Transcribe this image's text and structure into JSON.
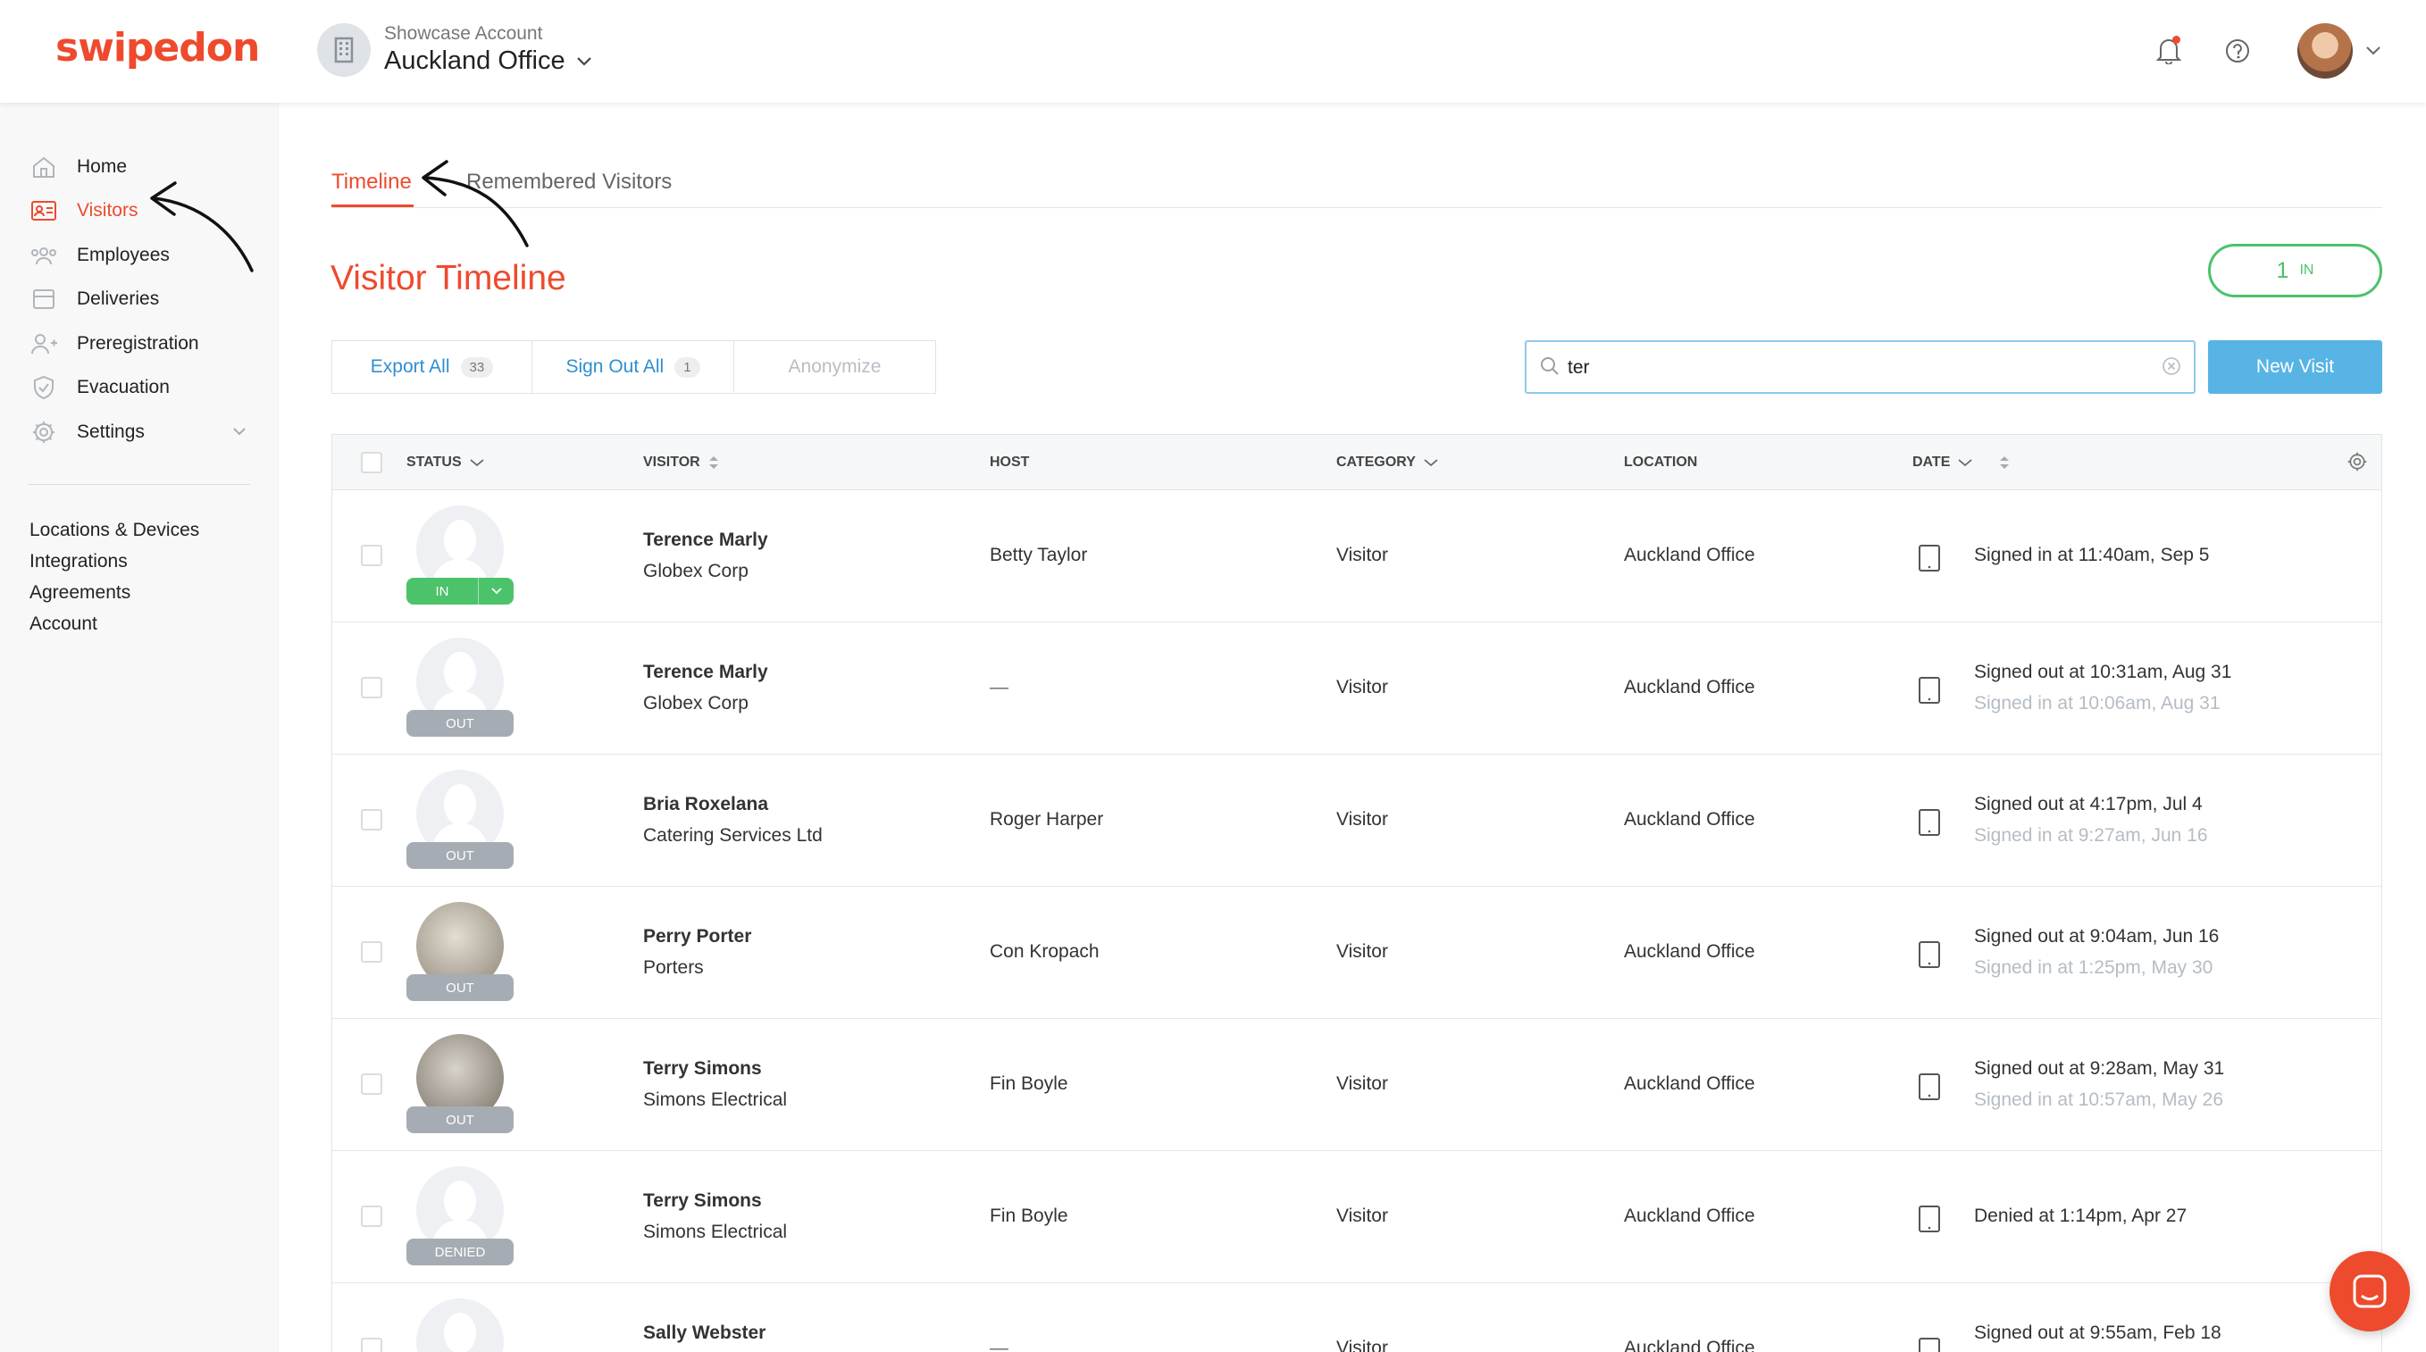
{
  "brand": {
    "logo_text": "swipedon",
    "accent": "#ee4a2d"
  },
  "header": {
    "account_label": "Showcase Account",
    "location_title": "Auckland Office",
    "icons": [
      "building-icon",
      "chevron-down-icon",
      "bell-icon",
      "help-icon",
      "avatar",
      "chevron-down-icon"
    ]
  },
  "sidebar": {
    "items": [
      {
        "label": "Home",
        "icon": "home-icon"
      },
      {
        "label": "Visitors",
        "icon": "visitor-card-icon"
      },
      {
        "label": "Employees",
        "icon": "people-icon"
      },
      {
        "label": "Deliveries",
        "icon": "box-icon"
      },
      {
        "label": "Preregistration",
        "icon": "add-user-icon"
      },
      {
        "label": "Evacuation",
        "icon": "shield-icon"
      },
      {
        "label": "Settings",
        "icon": "gear-icon"
      }
    ],
    "links": [
      "Locations & Devices",
      "Integrations",
      "Agreements",
      "Account"
    ]
  },
  "tabs": [
    {
      "label": "Timeline",
      "active": true
    },
    {
      "label": "Remembered Visitors",
      "active": false
    }
  ],
  "main": {
    "title": "Visitor Timeline",
    "in_count": {
      "number": "1",
      "label": "IN"
    },
    "actions": {
      "export_all": {
        "label": "Export All",
        "count": "33"
      },
      "sign_out_all": {
        "label": "Sign Out All",
        "count": "1"
      },
      "anonymize": {
        "label": "Anonymize"
      }
    },
    "search": {
      "value": "ter"
    },
    "new_visit_label": "New Visit"
  },
  "table": {
    "columns": [
      "STATUS",
      "VISITOR",
      "HOST",
      "CATEGORY",
      "LOCATION",
      "DATE"
    ],
    "rows": [
      {
        "status": "IN",
        "name": "Terence Marly",
        "company": "Globex Corp",
        "host": "Betty Taylor",
        "category": "Visitor",
        "location": "Auckland Office",
        "date_primary": "Signed in at 11:40am, Sep 5",
        "date_secondary": ""
      },
      {
        "status": "OUT",
        "name": "Terence Marly",
        "company": "Globex Corp",
        "host": "—",
        "category": "Visitor",
        "location": "Auckland Office",
        "date_primary": "Signed out at 10:31am, Aug 31",
        "date_secondary": "Signed in at 10:06am, Aug 31"
      },
      {
        "status": "OUT",
        "name": "Bria Roxelana",
        "company": "Catering Services Ltd",
        "host": "Roger Harper",
        "category": "Visitor",
        "location": "Auckland Office",
        "date_primary": "Signed out at 4:17pm, Jul 4",
        "date_secondary": "Signed in at 9:27am, Jun 16"
      },
      {
        "status": "OUT",
        "name": "Perry Porter",
        "company": "Porters",
        "host": "Con Kropach",
        "category": "Visitor",
        "location": "Auckland Office",
        "date_primary": "Signed out at 9:04am, Jun 16",
        "date_secondary": "Signed in at 1:25pm, May 30"
      },
      {
        "status": "OUT",
        "name": "Terry Simons",
        "company": "Simons Electrical",
        "host": "Fin Boyle",
        "category": "Visitor",
        "location": "Auckland Office",
        "date_primary": "Signed out at 9:28am, May 31",
        "date_secondary": "Signed in at 10:57am, May 26"
      },
      {
        "status": "DENIED",
        "name": "Terry Simons",
        "company": "Simons Electrical",
        "host": "Fin Boyle",
        "category": "Visitor",
        "location": "Auckland Office",
        "date_primary": "Denied at 1:14pm, Apr 27",
        "date_secondary": ""
      },
      {
        "status": "",
        "name": "Sally Webster",
        "company": "",
        "host": "—",
        "category": "Visitor",
        "location": "Auckland Office",
        "date_primary": "Signed out at 9:55am, Feb 18",
        "date_secondary": ""
      }
    ]
  },
  "colors": {
    "in_green": "#4cc26a",
    "out_gray": "#a6acb3",
    "link_blue": "#2f8fd0",
    "button_blue": "#57b4e5"
  }
}
